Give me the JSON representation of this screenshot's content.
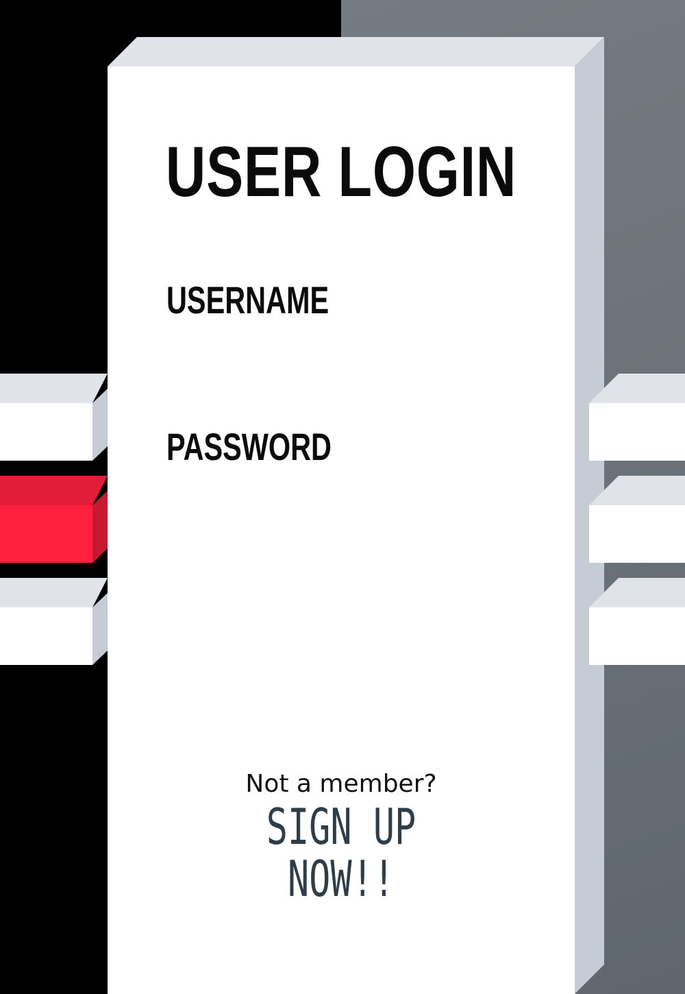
{
  "login": {
    "title": "USER LOGIN",
    "username_label": "USERNAME",
    "username_value": "",
    "password_label": "PASSWORD",
    "password_value": ""
  },
  "signup": {
    "prompt": "Not a member?",
    "link_line1": "SIGN UP",
    "link_line2": "NOW!!"
  },
  "colors": {
    "accent_tab": "#ff2040",
    "signup_text": "#2f3d48",
    "card": "#ffffff",
    "background_left": "#000000",
    "background_right": "#6b7279"
  }
}
